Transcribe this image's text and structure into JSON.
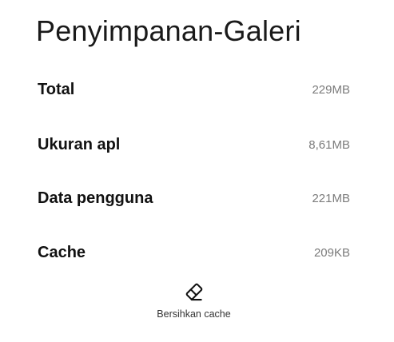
{
  "header": {
    "title": "Penyimpanan-Galeri"
  },
  "storage": {
    "rows": [
      {
        "label": "Total",
        "value": "229MB"
      },
      {
        "label": "Ukuran apl",
        "value": "8,61MB"
      },
      {
        "label": "Data pengguna",
        "value": "221MB"
      },
      {
        "label": "Cache",
        "value": "209KB"
      }
    ]
  },
  "actions": {
    "clear_cache": {
      "label": "Bersihkan cache",
      "icon": "eraser-icon"
    }
  }
}
